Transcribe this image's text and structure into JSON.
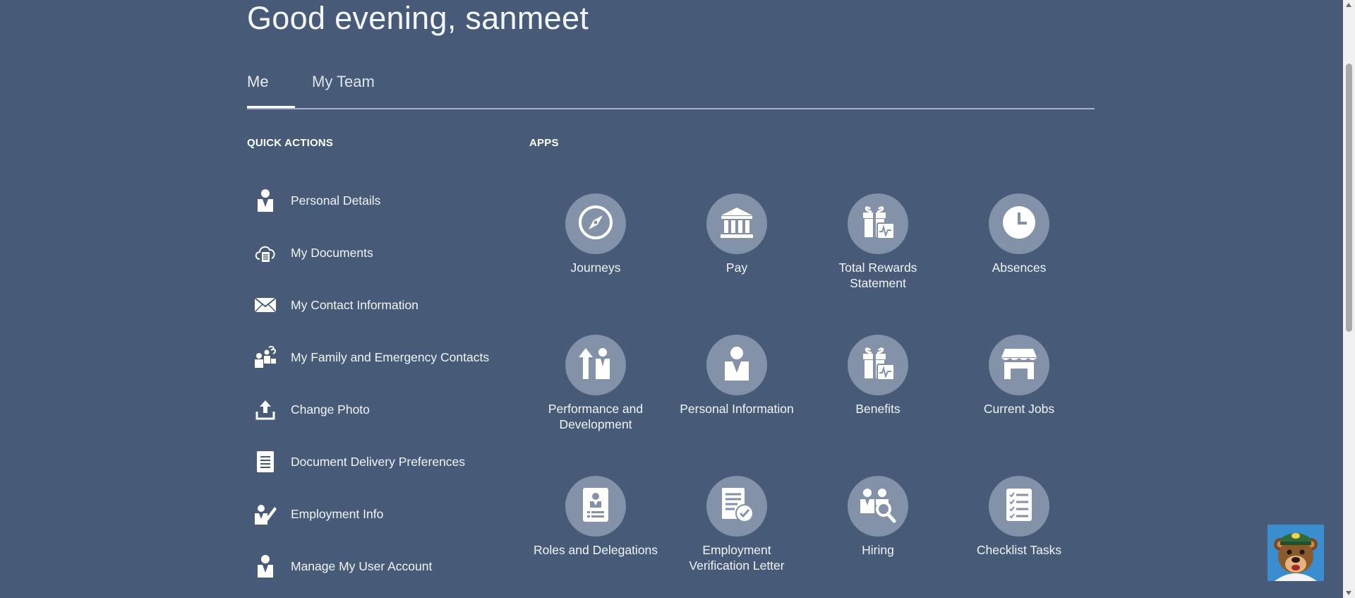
{
  "header": {
    "greeting": "Good evening, sanmeet"
  },
  "tabs": [
    {
      "label": "Me",
      "active": true
    },
    {
      "label": "My Team",
      "active": false
    }
  ],
  "quick_actions": {
    "title": "QUICK ACTIONS",
    "items": [
      {
        "label": "Personal Details",
        "icon": "person-icon"
      },
      {
        "label": "My Documents",
        "icon": "cloud-document-icon"
      },
      {
        "label": "My Contact Information",
        "icon": "envelope-icon"
      },
      {
        "label": "My Family and Emergency Contacts",
        "icon": "family-contacts-icon"
      },
      {
        "label": "Change Photo",
        "icon": "upload-icon"
      },
      {
        "label": "Document Delivery Preferences",
        "icon": "document-icon"
      },
      {
        "label": "Employment Info",
        "icon": "person-edit-icon"
      },
      {
        "label": "Manage My User Account",
        "icon": "person-icon"
      }
    ]
  },
  "apps": {
    "title": "APPS",
    "items": [
      {
        "label": "Journeys",
        "icon": "compass-icon"
      },
      {
        "label": "Pay",
        "icon": "bank-icon"
      },
      {
        "label": "Total Rewards Statement",
        "icon": "gift-chart-icon"
      },
      {
        "label": "Absences",
        "icon": "clock-icon"
      },
      {
        "label": "Performance and Development",
        "icon": "growth-person-icon"
      },
      {
        "label": "Personal Information",
        "icon": "person-icon"
      },
      {
        "label": "Benefits",
        "icon": "gift-chart-icon"
      },
      {
        "label": "Current Jobs",
        "icon": "storefront-icon"
      },
      {
        "label": "Roles and Delegations",
        "icon": "badge-icon"
      },
      {
        "label": "Employment Verification Letter",
        "icon": "document-check-icon"
      },
      {
        "label": "Hiring",
        "icon": "people-search-icon"
      },
      {
        "label": "Checklist Tasks",
        "icon": "checklist-icon"
      }
    ]
  },
  "colors": {
    "background": "#475a78",
    "icon_circle": "#8392a8",
    "text": "#ffffff"
  }
}
